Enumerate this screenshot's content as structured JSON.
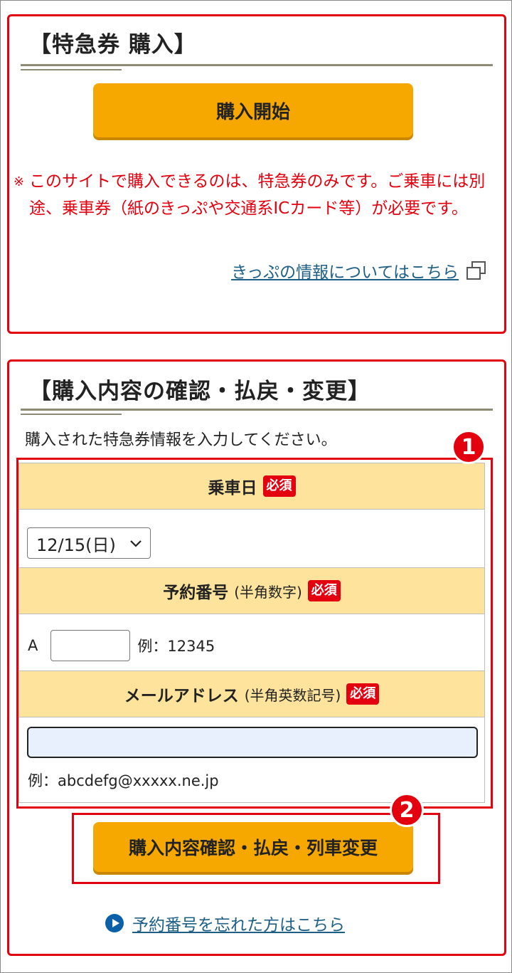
{
  "purchase_section": {
    "title": "【特急券 購入】",
    "start_button": "購入開始",
    "notice_mark": "※",
    "notice": "このサイトで購入できるのは、特急券のみです。ご乗車には別途、乗車券（紙のきっぷや交通系ICカード等）が必要です。",
    "ticket_info_link": "きっぷの情報についてはこちら",
    "ext_icon": "external-window-icon"
  },
  "confirm_section": {
    "title": "【購入内容の確認・払戻・変更】",
    "intro": "購入された特急券情報を入力してください。",
    "required_label": "必須",
    "date_field": {
      "label": "乗車日",
      "selected": "12/15(日)"
    },
    "reservation_field": {
      "label": "予約番号",
      "note": "(半角数字)",
      "prefix": "A",
      "value": "",
      "example": "例：12345"
    },
    "email_field": {
      "label": "メールアドレス",
      "note": "(半角英数記号)",
      "value": "",
      "example": "例：abcdefg@xxxxx.ne.jp"
    },
    "submit_button": "購入内容確認・払戻・列車変更",
    "forgot_link": "予約番号を忘れた方はこちら"
  },
  "callouts": {
    "badge1": "1",
    "badge2": "2"
  },
  "colors": {
    "accent_red": "#e3000f",
    "button_orange": "#f6a800",
    "header_yellow": "#fde39b",
    "link_blue": "#1d5f86"
  }
}
